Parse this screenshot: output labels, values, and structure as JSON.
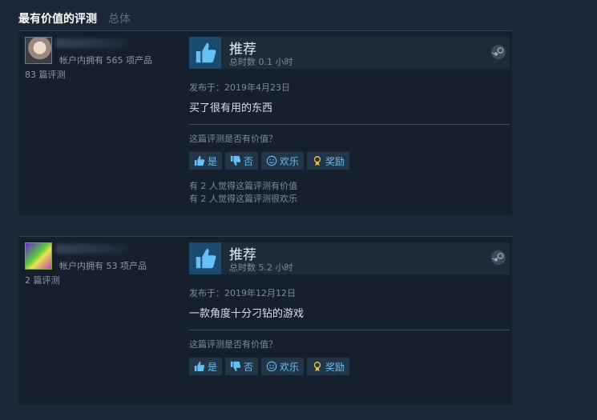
{
  "header": {
    "title": "最有价值的评测",
    "subtitle": "总体"
  },
  "labels": {
    "recommend": "推荐",
    "helpful_question": "这篇评测是否有价值？",
    "yes": "是",
    "no": "否",
    "funny": "欢乐",
    "award": "奖励"
  },
  "reviews": [
    {
      "owned": "帐户内拥有 565 项产品",
      "review_count": "83 篇评测",
      "playtime": "总时数 0.1 小时",
      "posted": "发布于：2019年4月23日",
      "text": "买了很有用的东西",
      "helpful_stat": "有 2 人觉得这篇评测有价值",
      "funny_stat": "有 2 人觉得这篇评测很欢乐"
    },
    {
      "owned": "帐户内拥有 53 项产品",
      "review_count": "2 篇评测",
      "playtime": "总时数 5.2 小时",
      "posted": "发布于：2019年12月12日",
      "text": "一款角度十分刁钻的游戏"
    }
  ],
  "icons": {
    "thumbs_up": "thumbs-up-icon",
    "thumbs_down": "thumbs-down-icon",
    "smile": "smile-icon",
    "award": "award-icon",
    "steam": "steam-icon"
  },
  "colors": {
    "accent": "#66c0f4",
    "background": "#1b2838",
    "panel": "#16202d",
    "award": "#e8b93a"
  }
}
